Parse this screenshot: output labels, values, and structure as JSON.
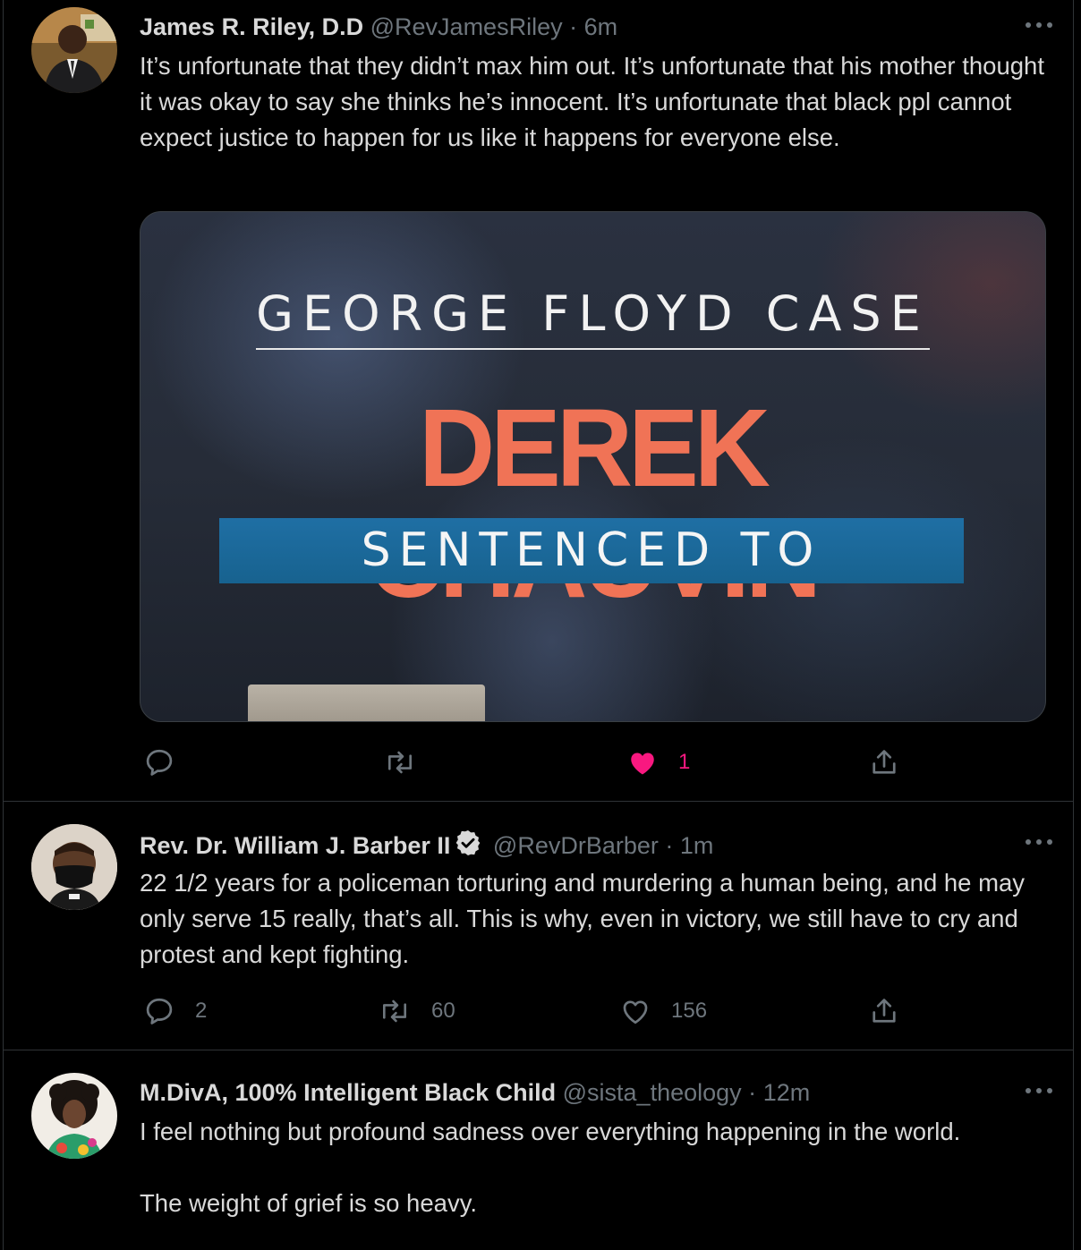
{
  "tweets": [
    {
      "name": "James R. Riley, D.D",
      "handle": "@RevJamesRiley",
      "separator": "·",
      "time": "6m",
      "verified": false,
      "text": "It’s unfortunate that they didn’t max him out. It’s unfortunate that his mother thought it was okay to say she thinks he’s innocent. It’s unfortunate that black ppl cannot expect justice to happen for us like it happens for everyone else.",
      "media": {
        "kicker": "GEORGE FLOYD CASE",
        "headline": "DEREK CHAUVIN",
        "banner": "SENTENCED TO"
      },
      "replies": "",
      "retweets": "",
      "likes": "1",
      "liked": true
    },
    {
      "name": "Rev. Dr. William J. Barber II",
      "handle": "@RevDrBarber",
      "separator": "·",
      "time": "1m",
      "verified": true,
      "text": "22 1/2 years for a policeman torturing and murdering a human being, and he may only serve 15 really, that’s all. This is why, even in victory, we still have to cry and protest and kept fighting.",
      "replies": "2",
      "retweets": "60",
      "likes": "156",
      "liked": false
    },
    {
      "name": "M.DivA, 100% Intelligent Black Child",
      "handle": "@sista_theology",
      "separator": "·",
      "time": "12m",
      "verified": false,
      "text": "I feel nothing but profound sadness over everything happening in the world.\n\nThe weight of grief is so heavy."
    }
  ],
  "colors": {
    "background": "#000000",
    "text": "#d9d9d9",
    "secondary": "#6e767d",
    "like": "#f91880",
    "divider": "#2f3336"
  },
  "icons": [
    "reply-icon",
    "retweet-icon",
    "like-icon",
    "share-icon",
    "more-icon",
    "verified-badge-icon"
  ]
}
